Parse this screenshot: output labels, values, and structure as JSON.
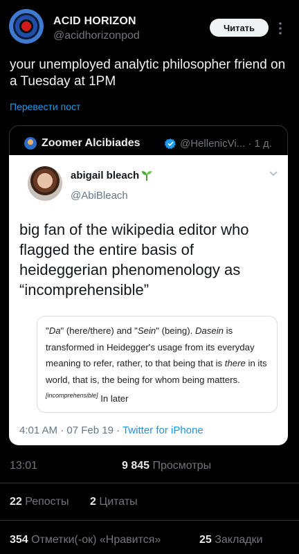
{
  "author": {
    "name": "ACID HORIZON",
    "handle": "@acidhorizonpod",
    "follow_label": "Читать"
  },
  "tweet": {
    "text": "your unemployed analytic philosopher friend on a Tuesday at 1PM",
    "translate_label": "Перевести пост"
  },
  "quoted": {
    "name": "Zoomer Alcibiades",
    "handle": "@HellenicVi... · 1 д.",
    "image": {
      "name": "abigail bleach",
      "handle": "@AbiBleach",
      "text": "big fan of the wikipedia editor who flagged the entire basis of heideggerian phenomenology as “incomprehensible”",
      "wiki": {
        "part1": "\"",
        "da": "Da",
        "part2": "\" (here/there) and \"",
        "sein": "Sein",
        "part3": "\" (being). ",
        "dasein": "Dasein",
        "part4": " is transformed in Heidegger's usage from its everyday meaning to refer, rather, to that being that is ",
        "there": "there",
        "part5": " in its world, that is, the being for whom being matters.",
        "sup": "[incomprehensible]",
        "part6": " In later"
      },
      "footer_time": "4:01 AM · 07 Feb 19 · ",
      "footer_source": "Twitter for iPhone"
    }
  },
  "meta": {
    "time": "13:01",
    "views_count": "9 845",
    "views_label": " Просмотры",
    "reposts_count": "22",
    "reposts_label": " Репосты",
    "quotes_count": "2",
    "quotes_label": " Цитаты",
    "likes_count": "354",
    "likes_label": " Отметки(-ок) «Нравится»",
    "bookmarks_count": "25",
    "bookmarks_label": " Закладки"
  },
  "colors": {
    "background": "#000000",
    "link": "#1d9bf0",
    "muted": "#71767b",
    "verified": "#1d9bf0"
  }
}
